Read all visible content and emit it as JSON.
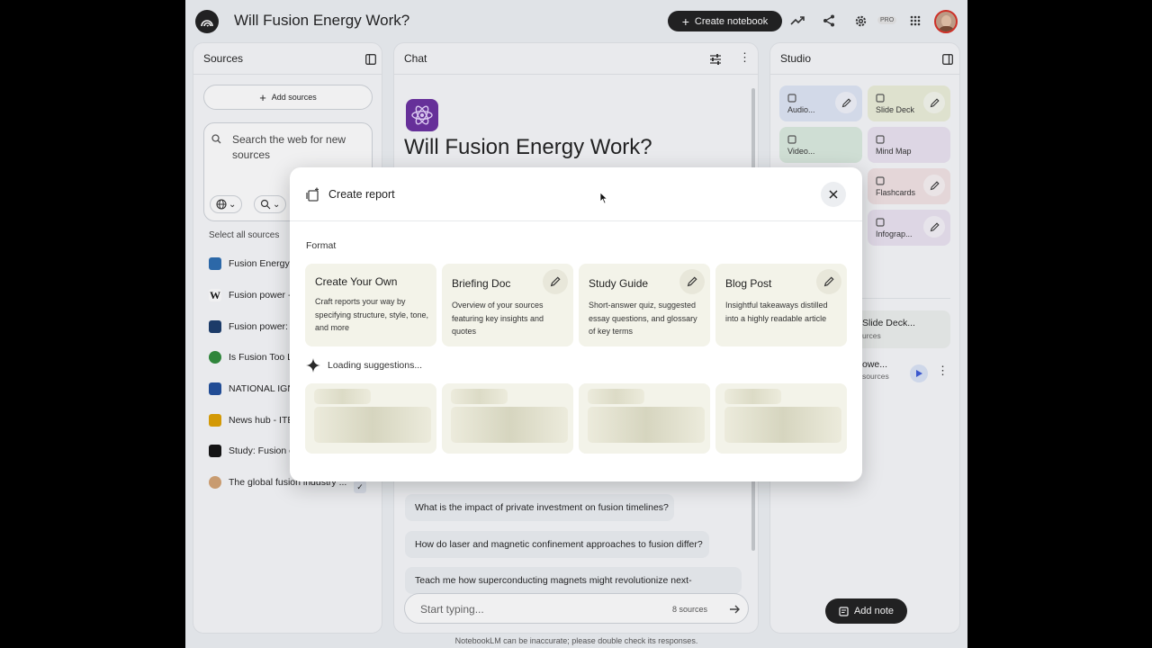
{
  "header": {
    "title": "Will Fusion Energy Work?",
    "create_notebook_label": "Create notebook",
    "pro_badge": "PRO"
  },
  "sources": {
    "title": "Sources",
    "add_sources_label": "Add sources",
    "search_placeholder": "Search the web for new sources",
    "select_all_label": "Select all sources",
    "items": [
      {
        "label": "Fusion Energy",
        "icon_color": "#2b6cb0"
      },
      {
        "label": "Fusion power -",
        "icon_color": "#ffffff"
      },
      {
        "label": "Fusion power:",
        "icon_color": "#1a3b6b"
      },
      {
        "label": "Is Fusion Too L",
        "icon_color": "#2e8b3a"
      },
      {
        "label": "NATIONAL IGN",
        "icon_color": "#1f4e9c"
      },
      {
        "label": "News hub - ITE",
        "icon_color": "#e0a100"
      },
      {
        "label": "Study: Fusion e",
        "icon_color": "#111111"
      },
      {
        "label": "The global fusion industry ...",
        "icon_color": "#d4a373"
      }
    ]
  },
  "chat": {
    "title": "Chat",
    "notebook_title": "Will Fusion Energy Work?",
    "suggestions": [
      "What is the impact of private investment on fusion timelines?",
      "How do laser and magnetic confinement approaches to fusion differ?",
      "Teach me how superconducting magnets might revolutionize next-"
    ],
    "input_placeholder": "Start typing...",
    "source_count": "8 sources",
    "disclaimer": "NotebookLM can be inaccurate; please double check its responses."
  },
  "studio": {
    "title": "Studio",
    "tiles": [
      {
        "label": "Audio...",
        "color": "#dfe6f6"
      },
      {
        "label": "Slide Deck",
        "color": "#ecefd9"
      },
      {
        "label": "Video...",
        "color": "#dcece0"
      },
      {
        "label": "Mind Map",
        "color": "#ebe3f1"
      },
      {
        "label": "Flashcards",
        "color": "#f2e3e4"
      },
      {
        "label": "Infograp...",
        "color": "#ebe3f1"
      }
    ],
    "notes": [
      {
        "title": "Slide Deck...",
        "meta": "urces"
      },
      {
        "title": "owe...",
        "meta": "sources"
      }
    ],
    "add_note_label": "Add note"
  },
  "modal": {
    "title": "Create report",
    "format_label": "Format",
    "cards": [
      {
        "title": "Create Your Own",
        "desc": "Craft reports your way by specifying structure, style, tone, and more",
        "editable": false
      },
      {
        "title": "Briefing Doc",
        "desc": "Overview of your sources featuring key insights and quotes",
        "editable": true
      },
      {
        "title": "Study Guide",
        "desc": "Short-answer quiz, suggested essay questions, and glossary of key terms",
        "editable": true
      },
      {
        "title": "Blog Post",
        "desc": "Insightful takeaways distilled into a highly readable article",
        "editable": true
      }
    ],
    "loading_label": "Loading suggestions..."
  }
}
